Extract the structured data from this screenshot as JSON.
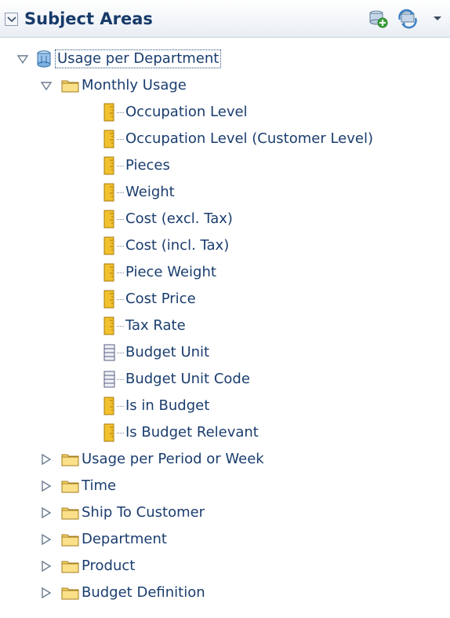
{
  "panel": {
    "title": "Subject Areas",
    "header_icons": [
      "collapse-icon",
      "add-subject-area-icon",
      "refresh-icon",
      "dropdown-arrow-icon"
    ]
  },
  "tree": {
    "root": {
      "label": "Usage per Department",
      "icon": "subject-area-cube-icon",
      "expanded": true,
      "folders": [
        {
          "label": "Monthly Usage",
          "expanded": true,
          "columns": [
            {
              "label": "Occupation Level",
              "kind": "measure"
            },
            {
              "label": "Occupation Level (Customer Level)",
              "kind": "measure"
            },
            {
              "label": "Pieces",
              "kind": "measure"
            },
            {
              "label": "Weight",
              "kind": "measure"
            },
            {
              "label": "Cost (excl. Tax)",
              "kind": "measure"
            },
            {
              "label": "Cost (incl. Tax)",
              "kind": "measure"
            },
            {
              "label": "Piece Weight",
              "kind": "measure"
            },
            {
              "label": "Cost Price",
              "kind": "measure"
            },
            {
              "label": "Tax Rate",
              "kind": "measure"
            },
            {
              "label": "Budget Unit",
              "kind": "attribute"
            },
            {
              "label": "Budget Unit Code",
              "kind": "attribute"
            },
            {
              "label": "Is in Budget",
              "kind": "measure"
            },
            {
              "label": "Is Budget Relevant",
              "kind": "measure"
            }
          ]
        },
        {
          "label": "Usage per Period or Week",
          "expanded": false
        },
        {
          "label": "Time",
          "expanded": false
        },
        {
          "label": "Ship To Customer",
          "expanded": false
        },
        {
          "label": "Department",
          "expanded": false
        },
        {
          "label": "Product",
          "expanded": false
        },
        {
          "label": "Budget Definition",
          "expanded": false
        }
      ]
    }
  }
}
